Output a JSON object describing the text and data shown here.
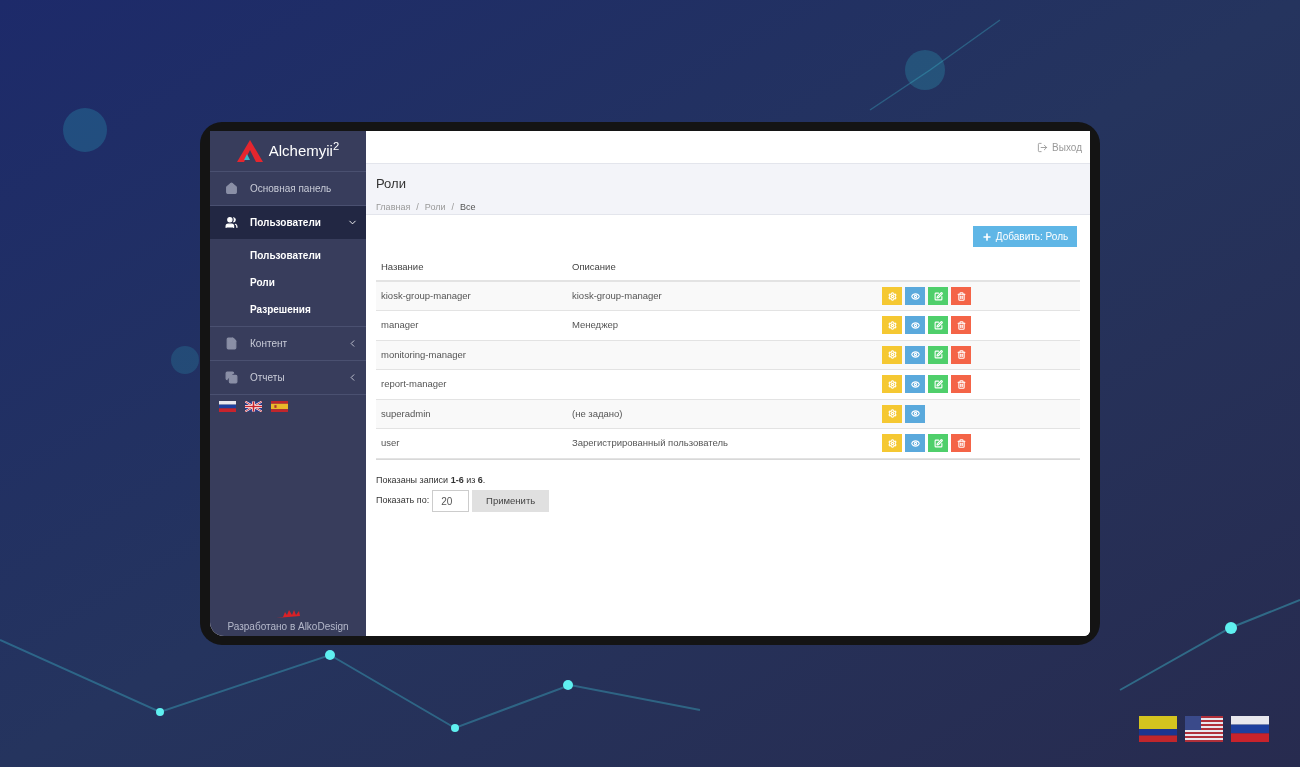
{
  "sidebar": {
    "logo": "Alchemyii$^{2}$",
    "items": [
      {
        "kind": "home",
        "label": "Основная панель",
        "selected": false,
        "has_submenu": false
      },
      {
        "kind": "users",
        "label": "Пользователи",
        "expanded": true,
        "selected": true,
        "has_submenu": true,
        "children": [
          {
            "label": "Пользователи"
          },
          {
            "label": "Роли"
          },
          {
            "label": "Разрешения"
          }
        ]
      },
      {
        "kind": "file",
        "label": "Контент",
        "expanded": false,
        "selected": false,
        "has_submenu": true
      },
      {
        "kind": "copy",
        "label": "Отчеты",
        "expanded": false,
        "selected": false,
        "has_submenu": true
      }
    ],
    "footer": "Разработано в AlkoDesign"
  },
  "topbar": {
    "logout": "Выход"
  },
  "page": {
    "title": "Роли",
    "breadcrumbs": [
      "Главная",
      "Роли",
      "Все"
    ],
    "breadcrumb_separator": "/",
    "add_button": "Добавить: Роль"
  },
  "table": {
    "columns": [
      "Название",
      "Описание"
    ],
    "rows": [
      {
        "name": "kiosk-group-manager",
        "description": "kiosk-group-manager",
        "actions": [
          {
            "kind": "permissions"
          },
          {
            "kind": "view"
          },
          {
            "kind": "edit"
          },
          {
            "kind": "delete"
          }
        ]
      },
      {
        "name": "manager",
        "description": "Менеджер",
        "actions": [
          {
            "kind": "permissions"
          },
          {
            "kind": "view"
          },
          {
            "kind": "edit"
          },
          {
            "kind": "delete"
          }
        ]
      },
      {
        "name": "monitoring-manager",
        "actions": [
          {
            "kind": "permissions"
          },
          {
            "kind": "view"
          },
          {
            "kind": "edit"
          },
          {
            "kind": "delete"
          }
        ]
      },
      {
        "name": "report-manager",
        "actions": [
          {
            "kind": "permissions"
          },
          {
            "kind": "view"
          },
          {
            "kind": "edit"
          },
          {
            "kind": "delete"
          }
        ]
      },
      {
        "name": "superadmin",
        "description": "(не задано)",
        "actions": [
          {
            "kind": "permissions"
          },
          {
            "kind": "view"
          }
        ]
      },
      {
        "name": "user",
        "description": "Зарегистрированный пользователь",
        "actions": [
          {
            "kind": "permissions"
          },
          {
            "kind": "view"
          },
          {
            "kind": "edit"
          },
          {
            "kind": "delete"
          }
        ]
      }
    ]
  },
  "summary": "Показаны записи **1-6** из **6**.",
  "page_size": {
    "label": "Показать по:",
    "value": "20",
    "button": "Применить"
  }
}
